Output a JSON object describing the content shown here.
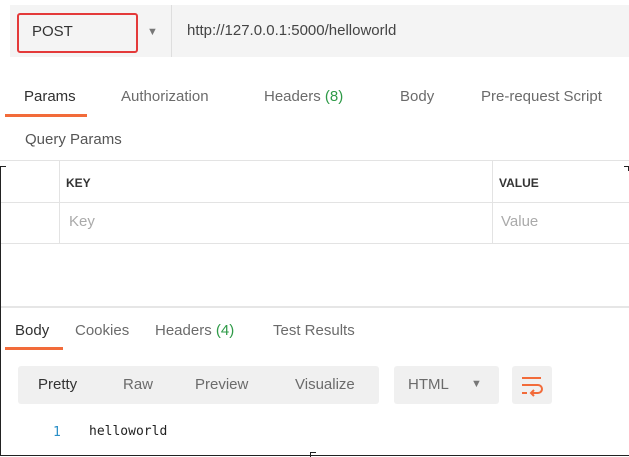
{
  "request": {
    "method": "POST",
    "url": "http://127.0.0.1:5000/helloworld"
  },
  "request_tabs": [
    {
      "label": "Params"
    },
    {
      "label": "Authorization"
    },
    {
      "label": "Headers",
      "count": "(8)"
    },
    {
      "label": "Body"
    },
    {
      "label": "Pre-request Script"
    }
  ],
  "params": {
    "section_label": "Query Params",
    "columns": [
      "KEY",
      "VALUE"
    ],
    "row_placeholders": {
      "key": "Key",
      "value": "Value"
    }
  },
  "response_tabs": [
    {
      "label": "Body"
    },
    {
      "label": "Cookies"
    },
    {
      "label": "Headers",
      "count": "(4)"
    },
    {
      "label": "Test Results"
    }
  ],
  "view": {
    "modes": [
      "Pretty",
      "Raw",
      "Preview",
      "Visualize"
    ],
    "format": "HTML",
    "wrap_icon": "wrap-lines-icon"
  },
  "response_body": {
    "line_number": "1",
    "line_text": "helloworld"
  },
  "colors": {
    "accent": "#f26b3a",
    "method_border": "#e43a3a",
    "count_green": "#2e9a47",
    "line_number": "#2a8fc7"
  }
}
